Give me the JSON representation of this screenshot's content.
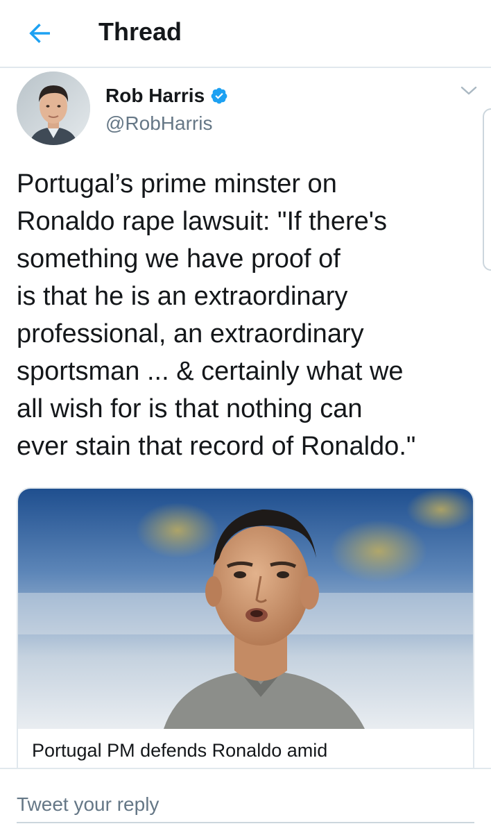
{
  "header": {
    "title": "Thread",
    "back_icon": "arrow-left-icon"
  },
  "tweet": {
    "author_name": "Rob Harris",
    "author_handle": "@RobHarris",
    "verified": true,
    "verified_icon": "verified-badge-icon",
    "caret_icon": "chevron-down-icon",
    "text_lines": [
      "Portugal’s prime minster on",
      "Ronaldo rape lawsuit:  \"If there's",
      "something we have proof of",
      "is that he is an extraordinary",
      "professional, an extraordinary",
      "sportsman ... & certainly what we",
      "all wish for is that nothing can",
      "ever stain that record of Ronaldo.\""
    ]
  },
  "card": {
    "title": "Portugal PM defends Ronaldo amid"
  },
  "reply": {
    "placeholder": "Tweet your reply"
  },
  "colors": {
    "accent": "#1da1f2",
    "text_primary": "#14171a",
    "text_secondary": "#657786",
    "divider": "#e1e8ed"
  }
}
